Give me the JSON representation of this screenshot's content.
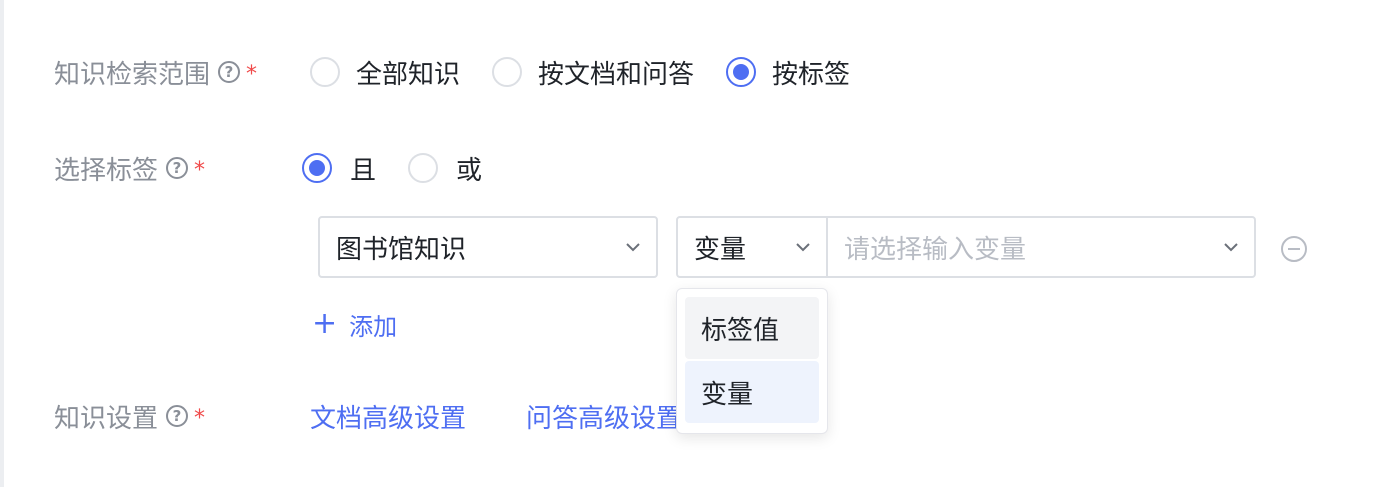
{
  "retrieval_scope": {
    "label": "知识检索范围",
    "options": [
      {
        "label": "全部知识",
        "checked": false
      },
      {
        "label": "按文档和问答",
        "checked": false
      },
      {
        "label": "按标签",
        "checked": true
      }
    ]
  },
  "tag_selection": {
    "label": "选择标签",
    "logic_options": [
      {
        "label": "且",
        "checked": true
      },
      {
        "label": "或",
        "checked": false
      }
    ],
    "tag_select_value": "图书馆知识",
    "type_select_value": "变量",
    "variable_select_placeholder": "请选择输入变量",
    "add_label": "添加",
    "dropdown_options": [
      {
        "label": "标签值",
        "state": "hover"
      },
      {
        "label": "变量",
        "state": "selected"
      }
    ]
  },
  "knowledge_settings": {
    "label": "知识设置",
    "links": [
      "文档高级设置",
      "问答高级设置"
    ]
  },
  "required_mark": "*",
  "help_mark": "?",
  "colors": {
    "accent": "#4e6ef2",
    "required": "#f04a4a",
    "label": "#8a8f98",
    "border": "#dcdfe4"
  }
}
